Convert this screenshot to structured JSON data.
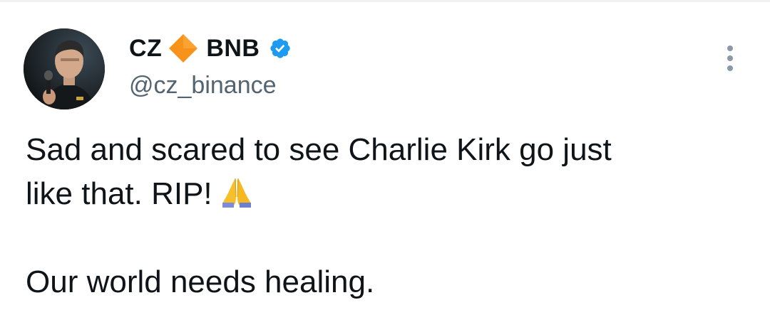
{
  "tweet": {
    "author": {
      "name_first": "CZ",
      "name_second": "BNB",
      "handle": "@cz_binance",
      "diamond_icon": "orange-diamond-icon",
      "verified_icon": "verified-badge-icon",
      "verified_color": "#1d9bf0",
      "diamond_color": "#f7931a"
    },
    "more_icon": "more-vertical-icon",
    "text": {
      "line1": "Sad and scared to see Charlie Kirk go just",
      "line2": "like that. RIP!",
      "line2_emoji": "folded-hands-icon",
      "line3": "Our world needs healing."
    }
  }
}
